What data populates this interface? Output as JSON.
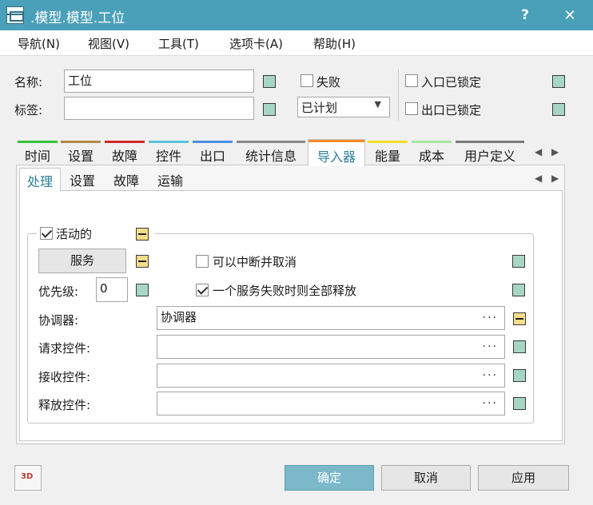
{
  "window": {
    "title": ".模型.模型.工位",
    "help_label": "?",
    "close_label": "✕"
  },
  "menu": [
    "导航(N)",
    "视图(V)",
    "工具(T)",
    "选项卡(A)",
    "帮助(H)"
  ],
  "header": {
    "name_label": "名称:",
    "name_value": "工位",
    "tag_label": "标签:",
    "tag_value": "",
    "failed_label": "失败",
    "failed_checked": false,
    "state_value": "已计划",
    "entry_locked_label": "入口已锁定",
    "entry_locked_checked": false,
    "exit_locked_label": "出口已锁定",
    "exit_locked_checked": false
  },
  "tabs": [
    {
      "label": "时间",
      "color": "#35c13a"
    },
    {
      "label": "设置",
      "color": "#b5874a"
    },
    {
      "label": "故障",
      "color": "#cf2a2a"
    },
    {
      "label": "控件",
      "color": "#58c3dc"
    },
    {
      "label": "出口",
      "color": "#4b8fe0"
    },
    {
      "label": "统计信息",
      "color": "#888888"
    },
    {
      "label": "导入器",
      "color": "#f08a24"
    },
    {
      "label": "能量",
      "color": "#f1e02a"
    },
    {
      "label": "成本",
      "color": "#a7e6a2"
    },
    {
      "label": "用户定义",
      "color": "#7a7a7a"
    }
  ],
  "subtabs": [
    "处理",
    "设置",
    "故障",
    "运输"
  ],
  "importer": {
    "active_label": "活动的",
    "active_checked": true,
    "services_button": "服务",
    "interrupt_label": "可以中断并取消",
    "interrupt_checked": false,
    "release_all_label": "一个服务失败时则全部释放",
    "release_all_checked": true,
    "priority_label": "优先级:",
    "priority_value": "0",
    "broker_label": "协调器:",
    "broker_value": "协调器",
    "request_label": "请求控件:",
    "request_value": "",
    "receive_label": "接收控件:",
    "receive_value": "",
    "release_label": "释放控件:",
    "release_value": "",
    "dots": "..."
  },
  "footer": {
    "badge_3d": "3D",
    "ok": "确定",
    "cancel": "取消",
    "apply": "应用"
  },
  "colors": {
    "titlebar": "#4aa0b8",
    "ok_button": "#7bb8c9",
    "accent_text": "#2a7f99"
  }
}
